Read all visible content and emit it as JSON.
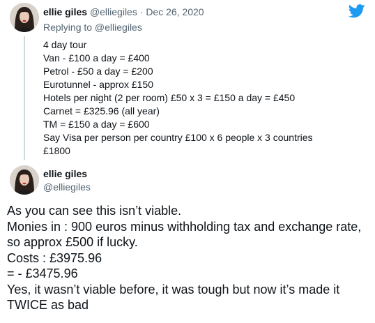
{
  "reply_tweet": {
    "author_name": "ellie giles",
    "author_handle": "@elliegiles",
    "separator": "·",
    "date": "Dec 26, 2020",
    "replying_to": "Replying to @elliegiles",
    "lines": [
      "4 day tour",
      "Van - £100 a day = £400",
      "Petrol - £50 a day = £200",
      "Eurotunnel - approx £150",
      "Hotels per night (2 per room) £50 x 3 = £150 a day = £450",
      "Carnet = £325.96 (all year)",
      "TM = £150 a day  = £600",
      "Say Visa per person per country £100 x 6 people x 3 countries",
      "£1800"
    ]
  },
  "main_tweet": {
    "author_name": "ellie giles",
    "author_handle": "@elliegiles",
    "lines": [
      "As you can see this isn’t viable.",
      "Monies in : 900 euros minus withholding tax and exchange rate, so approx £500 if lucky.",
      "Costs : £3975.96",
      "= - £3475.96",
      "Yes, it wasn’t viable before, it was tough but now it’s made it TWICE as bad"
    ]
  },
  "brand": {
    "icon": "twitter-bird-icon",
    "color": "#1d9bf0"
  },
  "colors": {
    "text": "#0f1419",
    "muted": "#536471",
    "thread_line": "#cfd9de"
  }
}
